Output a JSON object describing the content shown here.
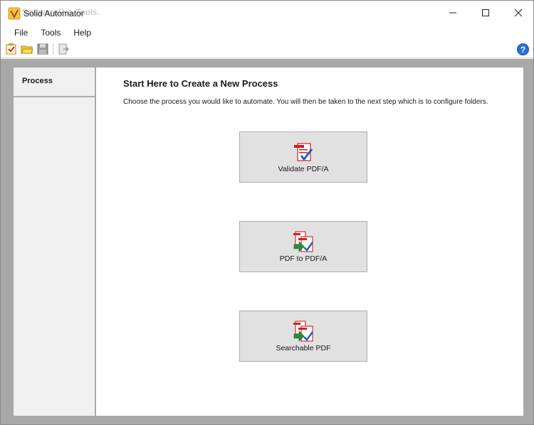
{
  "window": {
    "title": "Solid Automator",
    "watermark": "SoftwarePro Tools."
  },
  "menu": {
    "items": [
      "File",
      "Tools",
      "Help"
    ]
  },
  "toolbar": {
    "icons": [
      "new-process-icon",
      "open-folder-icon",
      "save-icon",
      "export-icon"
    ],
    "help_label": "?"
  },
  "sidebar": {
    "tab_label": "Process"
  },
  "main": {
    "heading": "Start Here to Create a New Process",
    "description": "Choose the process you would like to automate. You will then be taken to the next step which is to configure folders.",
    "processes": [
      {
        "label": "Validate PDF/A",
        "icon": "validate-pdfa-icon"
      },
      {
        "label": "PDF to PDF/A",
        "icon": "pdf-to-pdfa-icon"
      },
      {
        "label": "Searchable PDF",
        "icon": "searchable-pdf-icon"
      }
    ]
  },
  "colors": {
    "accent_red": "#d42020",
    "check_blue": "#1f5fc8",
    "arrow_green": "#2e8b3a",
    "help_blue": "#2a6fd6"
  }
}
